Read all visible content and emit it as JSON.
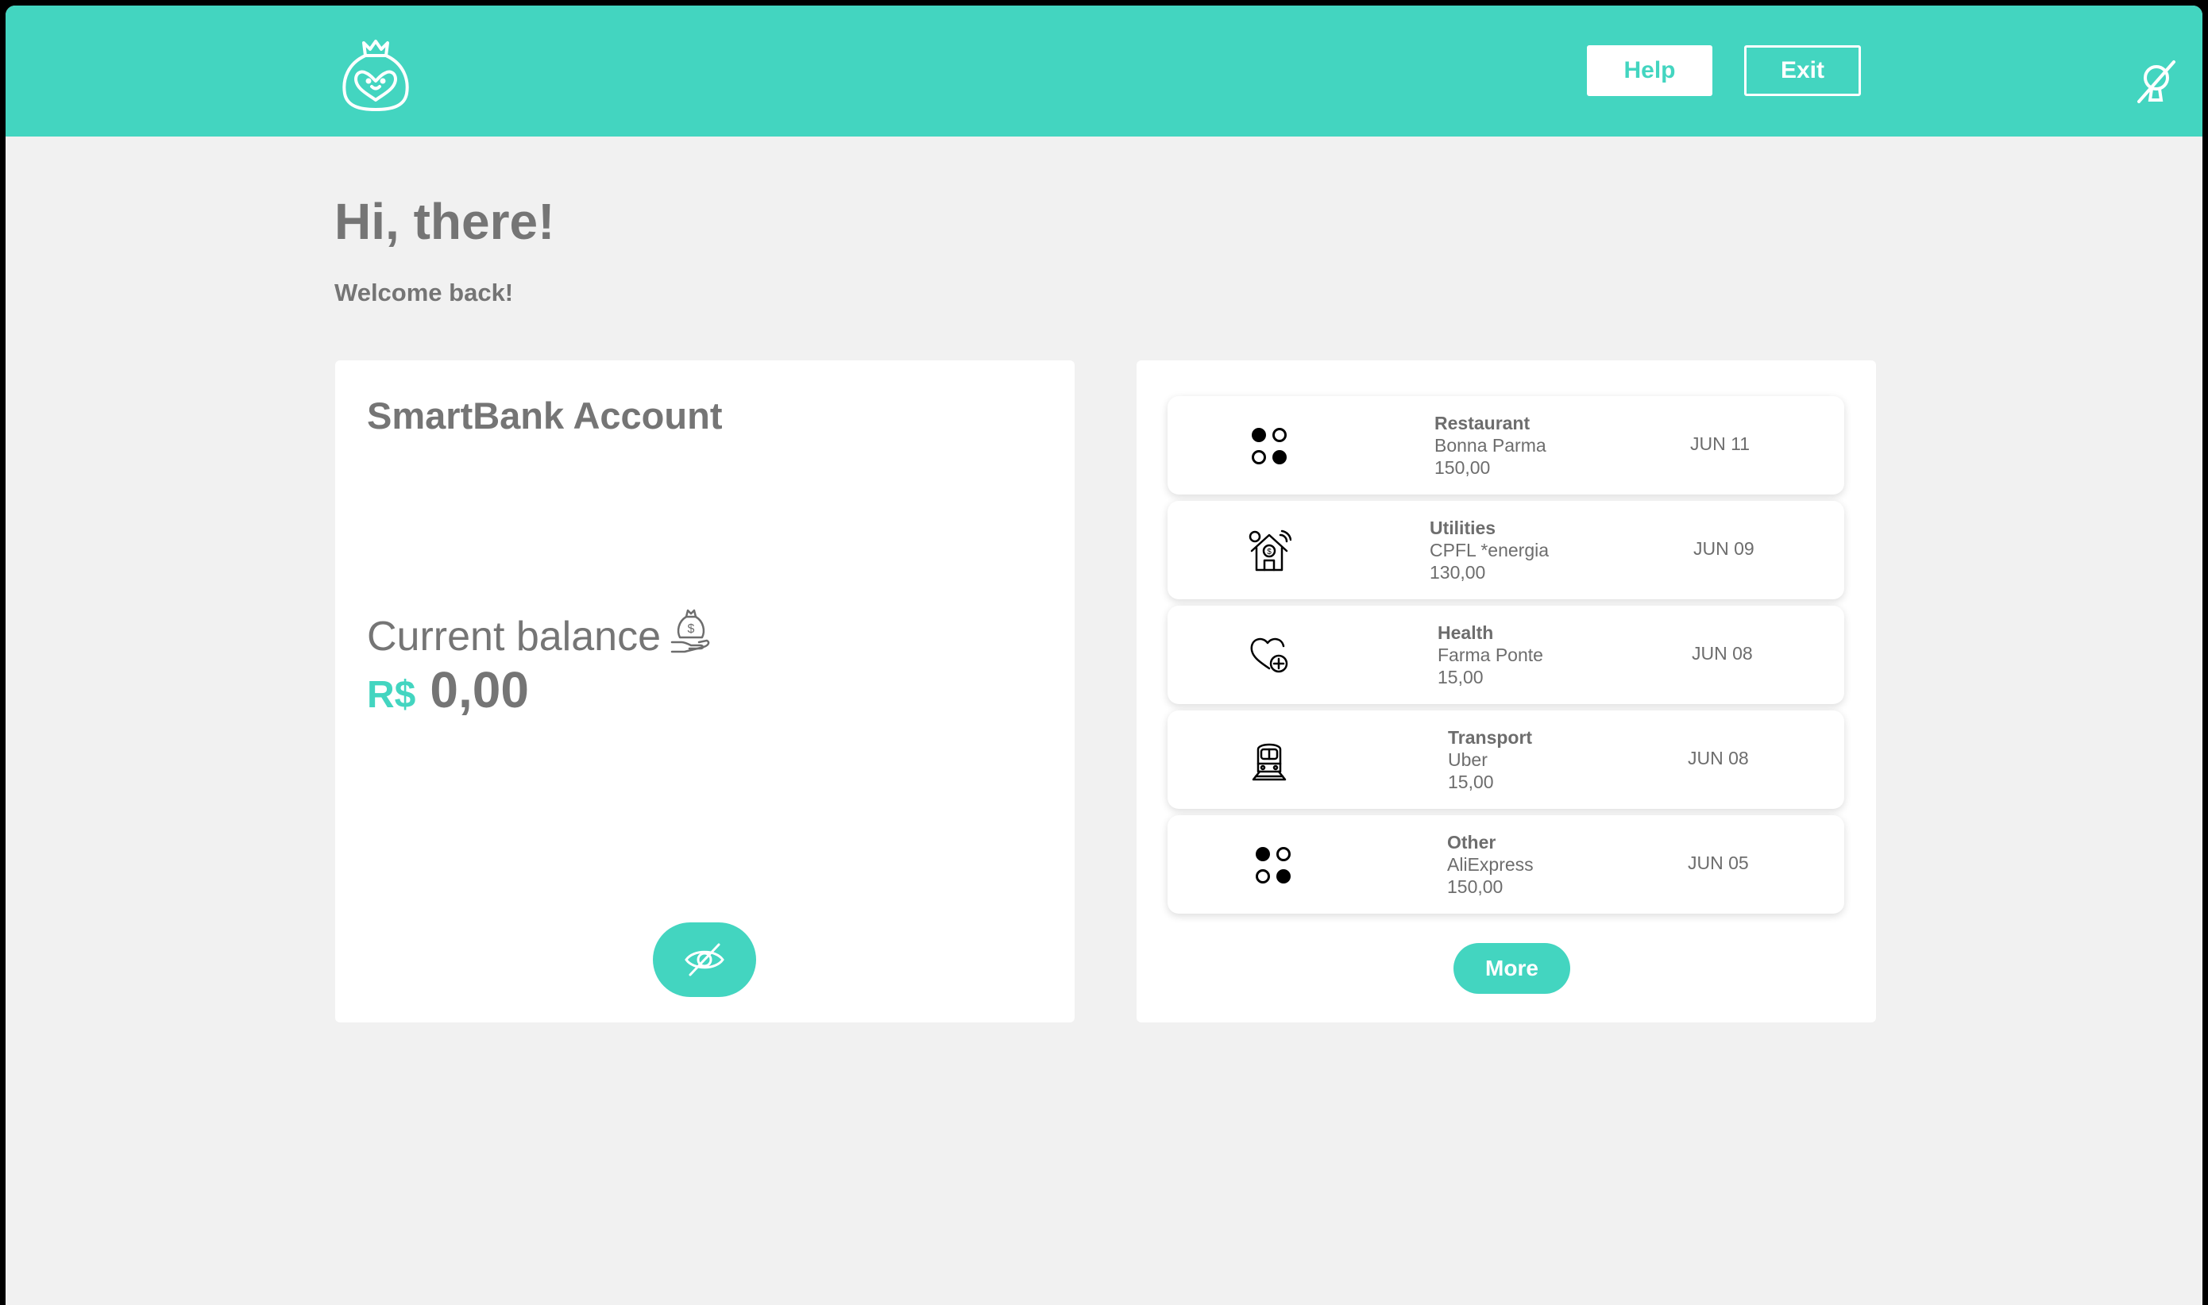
{
  "header": {
    "logo_icon": "money-bag-heart-icon",
    "help_label": "Help",
    "exit_label": "Exit",
    "accessibility_icon": "hide-animations-icon",
    "accent_color": "#43d5c0"
  },
  "greeting": {
    "title": "Hi, there!",
    "subtitle": "Welcome back!"
  },
  "account": {
    "title": "SmartBank Account",
    "balance_label": "Current balance",
    "balance_icon": "money-bag-hand-icon",
    "currency": "R$",
    "balance": "0,00",
    "toggle_icon": "eye-slash-icon"
  },
  "transactions": {
    "items": [
      {
        "category": "Restaurant",
        "merchant": "Bonna Parma",
        "amount": "150,00",
        "date": "JUN 11",
        "icon": "dots-grid-icon"
      },
      {
        "category": "Utilities",
        "merchant": "CPFL *energia",
        "amount": "130,00",
        "date": "JUN 09",
        "icon": "smart-home-icon"
      },
      {
        "category": "Health",
        "merchant": "Farma Ponte",
        "amount": "15,00",
        "date": "JUN 08",
        "icon": "heart-plus-icon"
      },
      {
        "category": "Transport",
        "merchant": "Uber",
        "amount": "15,00",
        "date": "JUN 08",
        "icon": "train-icon"
      },
      {
        "category": "Other",
        "merchant": "AliExpress",
        "amount": "150,00",
        "date": "JUN 05",
        "icon": "dots-grid-icon"
      }
    ],
    "more_label": "More"
  }
}
